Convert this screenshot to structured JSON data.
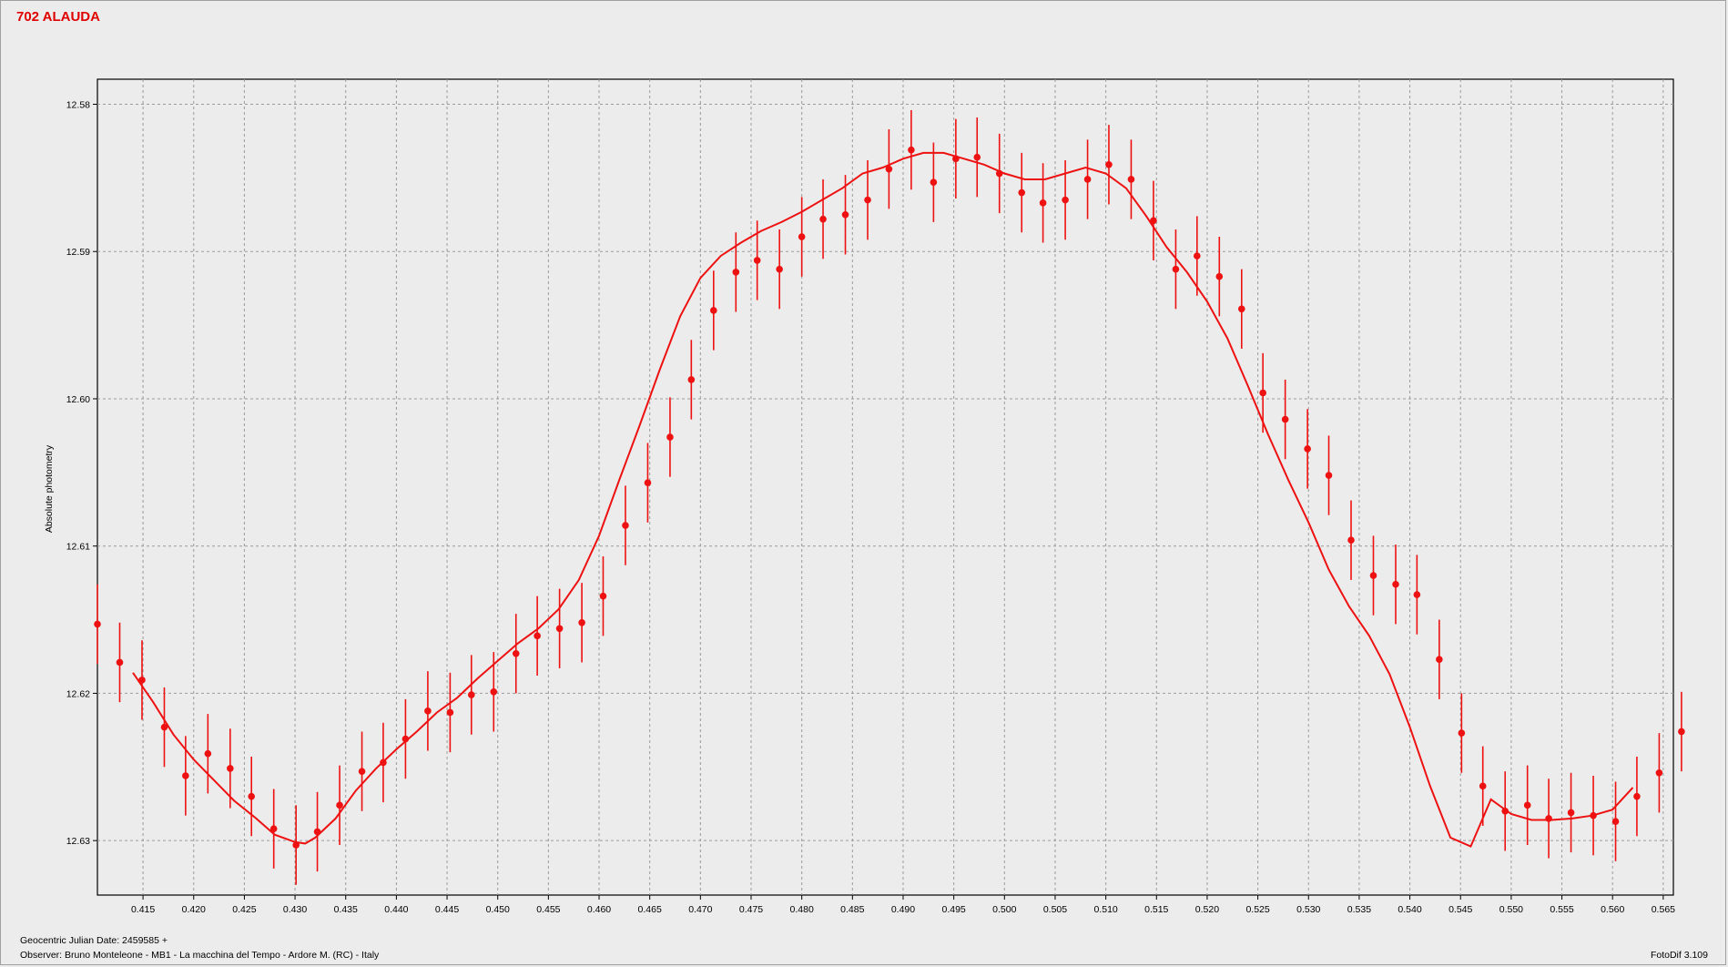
{
  "window": {
    "title": "702 ALAUDA",
    "footer_date": "Geocentric Julian Date: 2459585 +",
    "footer_observer": "Observer: Bruno Monteleone - MB1 - La macchina del Tempo - Ardore M. (RC) - Italy",
    "footer_software": "FotoDif 3.109"
  },
  "colors": {
    "series": "#ee1111",
    "grid": "#9a9a9a",
    "plot_bg": "#ececec"
  },
  "chart_data": {
    "type": "scatter",
    "title": "702 ALAUDA",
    "xlabel": "",
    "ylabel": "Absolute photometry",
    "xlim": [
      0.4105,
      0.566
    ],
    "ylim": [
      12.5783,
      12.6337
    ],
    "y_inverted": true,
    "grid": true,
    "x_ticks": [
      "0.415",
      "0.420",
      "0.425",
      "0.430",
      "0.435",
      "0.440",
      "0.445",
      "0.450",
      "0.455",
      "0.460",
      "0.465",
      "0.470",
      "0.475",
      "0.480",
      "0.485",
      "0.490",
      "0.495",
      "0.500",
      "0.505",
      "0.510",
      "0.515",
      "0.520",
      "0.525",
      "0.530",
      "0.535",
      "0.540",
      "0.545",
      "0.550",
      "0.555",
      "0.560",
      "0.565"
    ],
    "y_ticks": [
      "12.58",
      "12.59",
      "12.60",
      "12.61",
      "12.62",
      "12.63"
    ],
    "series": [
      {
        "kind": "points_with_error_bars",
        "x": [
          0.4105,
          0.4127,
          0.4149,
          0.4171,
          0.4192,
          0.4214,
          0.4236,
          0.4257,
          0.4279,
          0.4301,
          0.4322,
          0.4344,
          0.4366,
          0.4387,
          0.4409,
          0.4431,
          0.4453,
          0.4474,
          0.4496,
          0.4518,
          0.4539,
          0.4561,
          0.4583,
          0.4604,
          0.4626,
          0.4648,
          0.467,
          0.4691,
          0.4713,
          0.4735,
          0.4756,
          0.4778,
          0.48,
          0.4821,
          0.4843,
          0.4865,
          0.4886,
          0.4908,
          0.493,
          0.4952,
          0.4973,
          0.4995,
          0.5017,
          0.5038,
          0.506,
          0.5082,
          0.5103,
          0.5125,
          0.5147,
          0.5169,
          0.519,
          0.5212,
          0.5234,
          0.5255,
          0.5277,
          0.5299,
          0.532,
          0.5342,
          0.5364,
          0.5386,
          0.5407,
          0.5429,
          0.5451,
          0.5472,
          0.5494,
          0.5516,
          0.5537,
          0.5559,
          0.5581,
          0.5603,
          0.5624,
          0.5646,
          0.5668
        ],
        "y": [
          12.6153,
          12.6179,
          12.6191,
          12.6223,
          12.6256,
          12.6241,
          12.6251,
          12.627,
          12.6292,
          12.6303,
          12.6294,
          12.6276,
          12.6253,
          12.6247,
          12.6231,
          12.6212,
          12.6213,
          12.6201,
          12.6199,
          12.6173,
          12.6161,
          12.6156,
          12.6152,
          12.6134,
          12.6086,
          12.6057,
          12.6026,
          12.5987,
          12.594,
          12.5914,
          12.5906,
          12.5912,
          12.589,
          12.5878,
          12.5875,
          12.5865,
          12.5844,
          12.5831,
          12.5853,
          12.5837,
          12.5836,
          12.5847,
          12.586,
          12.5867,
          12.5865,
          12.5851,
          12.5841,
          12.5851,
          12.5879,
          12.5912,
          12.5903,
          12.5917,
          12.5939,
          12.5996,
          12.6014,
          12.6034,
          12.6052,
          12.6096,
          12.612,
          12.6126,
          12.6133,
          12.6177,
          12.6227,
          12.6263,
          12.628,
          12.6276,
          12.6285,
          12.6281,
          12.6283,
          12.6287,
          12.627,
          12.6254,
          12.6226
        ],
        "err": [
          0.0027,
          0.0027,
          0.0027,
          0.0027,
          0.0027,
          0.0027,
          0.0027,
          0.0027,
          0.0027,
          0.0027,
          0.0027,
          0.0027,
          0.0027,
          0.0027,
          0.0027,
          0.0027,
          0.0027,
          0.0027,
          0.0027,
          0.0027,
          0.0027,
          0.0027,
          0.0027,
          0.0027,
          0.0027,
          0.0027,
          0.0027,
          0.0027,
          0.0027,
          0.0027,
          0.0027,
          0.0027,
          0.0027,
          0.0027,
          0.0027,
          0.0027,
          0.0027,
          0.0027,
          0.0027,
          0.0027,
          0.0027,
          0.0027,
          0.0027,
          0.0027,
          0.0027,
          0.0027,
          0.0027,
          0.0027,
          0.0027,
          0.0027,
          0.0027,
          0.0027,
          0.0027,
          0.0027,
          0.0027,
          0.0027,
          0.0027,
          0.0027,
          0.0027,
          0.0027,
          0.0027,
          0.0027,
          0.0027,
          0.0027,
          0.0027,
          0.0027,
          0.0027,
          0.0027,
          0.0027,
          0.0027,
          0.0027,
          0.0027,
          0.0027
        ]
      },
      {
        "kind": "fit_line",
        "x": [
          0.414,
          0.416,
          0.418,
          0.42,
          0.422,
          0.424,
          0.426,
          0.428,
          0.43,
          0.431,
          0.432,
          0.434,
          0.436,
          0.438,
          0.44,
          0.442,
          0.444,
          0.446,
          0.448,
          0.45,
          0.452,
          0.454,
          0.456,
          0.458,
          0.46,
          0.462,
          0.464,
          0.466,
          0.468,
          0.47,
          0.472,
          0.474,
          0.476,
          0.478,
          0.48,
          0.482,
          0.484,
          0.486,
          0.488,
          0.49,
          0.492,
          0.494,
          0.496,
          0.498,
          0.5,
          0.502,
          0.504,
          0.506,
          0.508,
          0.51,
          0.512,
          0.514,
          0.516,
          0.518,
          0.52,
          0.522,
          0.524,
          0.526,
          0.528,
          0.53,
          0.532,
          0.534,
          0.536,
          0.538,
          0.54,
          0.542,
          0.544,
          0.546,
          0.548,
          0.55,
          0.552,
          0.554,
          0.556,
          0.558,
          0.56,
          0.562
        ],
        "y": [
          12.6186,
          12.6206,
          12.6228,
          12.6245,
          12.6259,
          12.6273,
          12.6284,
          12.6296,
          12.6301,
          12.6302,
          12.6298,
          12.6285,
          12.6266,
          12.6251,
          12.6238,
          12.6226,
          12.6213,
          12.6203,
          12.619,
          12.6178,
          12.6166,
          12.6156,
          12.6143,
          12.6123,
          12.6093,
          12.6055,
          12.6018,
          12.598,
          12.5944,
          12.5918,
          12.5903,
          12.5894,
          12.5886,
          12.588,
          12.5873,
          12.5865,
          12.5857,
          12.5847,
          12.5843,
          12.5837,
          12.5833,
          12.5833,
          12.5837,
          12.5841,
          12.5847,
          12.5851,
          12.5851,
          12.5847,
          12.5843,
          12.5847,
          12.5857,
          12.5876,
          12.5897,
          12.5914,
          12.5934,
          12.5959,
          12.5991,
          12.6024,
          12.6055,
          12.6084,
          12.6116,
          12.6141,
          12.6161,
          12.6187,
          12.6223,
          12.6263,
          12.6298,
          12.6304,
          12.6272,
          12.6282,
          12.6286,
          12.6286,
          12.6285,
          12.6283,
          12.6279,
          12.6264
        ]
      }
    ]
  }
}
